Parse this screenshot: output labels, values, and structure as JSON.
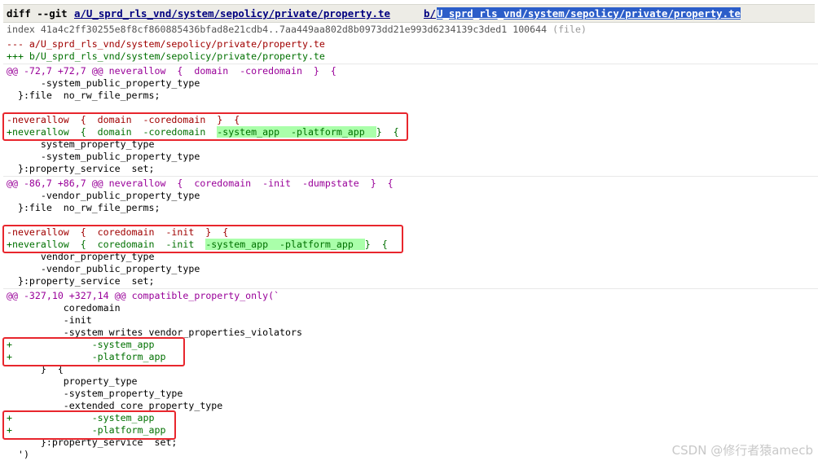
{
  "header": {
    "keyword": "diff --git",
    "path_a": "a/U_sprd_rls_vnd/system/sepolicy/private/property.te",
    "path_b_prefix": "b/",
    "path_b": "U_sprd_rls_vnd/system/sepolicy/private/property.te"
  },
  "index": {
    "text": "index 41a4c2ff30255e8f8cf860885436bfad8e21cdb4..7aa449aa802d8b0973dd21e993d6234139c3ded1 100644",
    "mode": "(file)"
  },
  "file_old": "--- a/U_sprd_rls_vnd/system/sepolicy/private/property.te",
  "file_new": "+++ b/U_sprd_rls_vnd/system/sepolicy/private/property.te",
  "hunks": [
    {
      "range": "@@ -72,7 +72,7 @@",
      "context": " neverallow  {  domain  -coredomain  }  {",
      "lines": [
        "      -system_public_property_type",
        "  }:file  no_rw_file_perms;",
        "",
        "-neverallow  {  domain  -coredomain  }  {",
        "+neverallow  {  domain  -coredomain  ",
        "      system_property_type",
        "      -system_public_property_type",
        "  }:property_service  set;"
      ],
      "added_highlight": "-system_app  -platform_app  ",
      "added_tail": "}  {"
    },
    {
      "range": "@@ -86,7 +86,7 @@",
      "context": " neverallow  {  coredomain  -init  -dumpstate  }  {",
      "lines": [
        "      -vendor_public_property_type",
        "  }:file  no_rw_file_perms;",
        "",
        "-neverallow  {  coredomain  -init  }  {",
        "+neverallow  {  coredomain  -init  ",
        "      vendor_property_type",
        "      -vendor_public_property_type",
        "  }:property_service  set;"
      ],
      "added_highlight": "-system_app  -platform_app  ",
      "added_tail": "}  {"
    },
    {
      "range": "@@ -327,10 +327,14 @@",
      "context": " compatible_property_only(`",
      "lines": [
        "          coredomain",
        "          -init",
        "          -system_writes_vendor_properties_violators",
        "+              -system_app",
        "+              -platform_app",
        "      }  {",
        "          property_type",
        "          -system_property_type",
        "          -extended_core_property_type",
        "+              -system_app",
        "+              -platform_app",
        "      }:property_service  set;",
        "  ')"
      ]
    }
  ],
  "watermark": "CSDN @修行者猿amecb",
  "colors": {
    "annotation_box": "#e8262d",
    "added": "#007000",
    "removed": "#a00000",
    "highlight": "#aaffaa"
  }
}
